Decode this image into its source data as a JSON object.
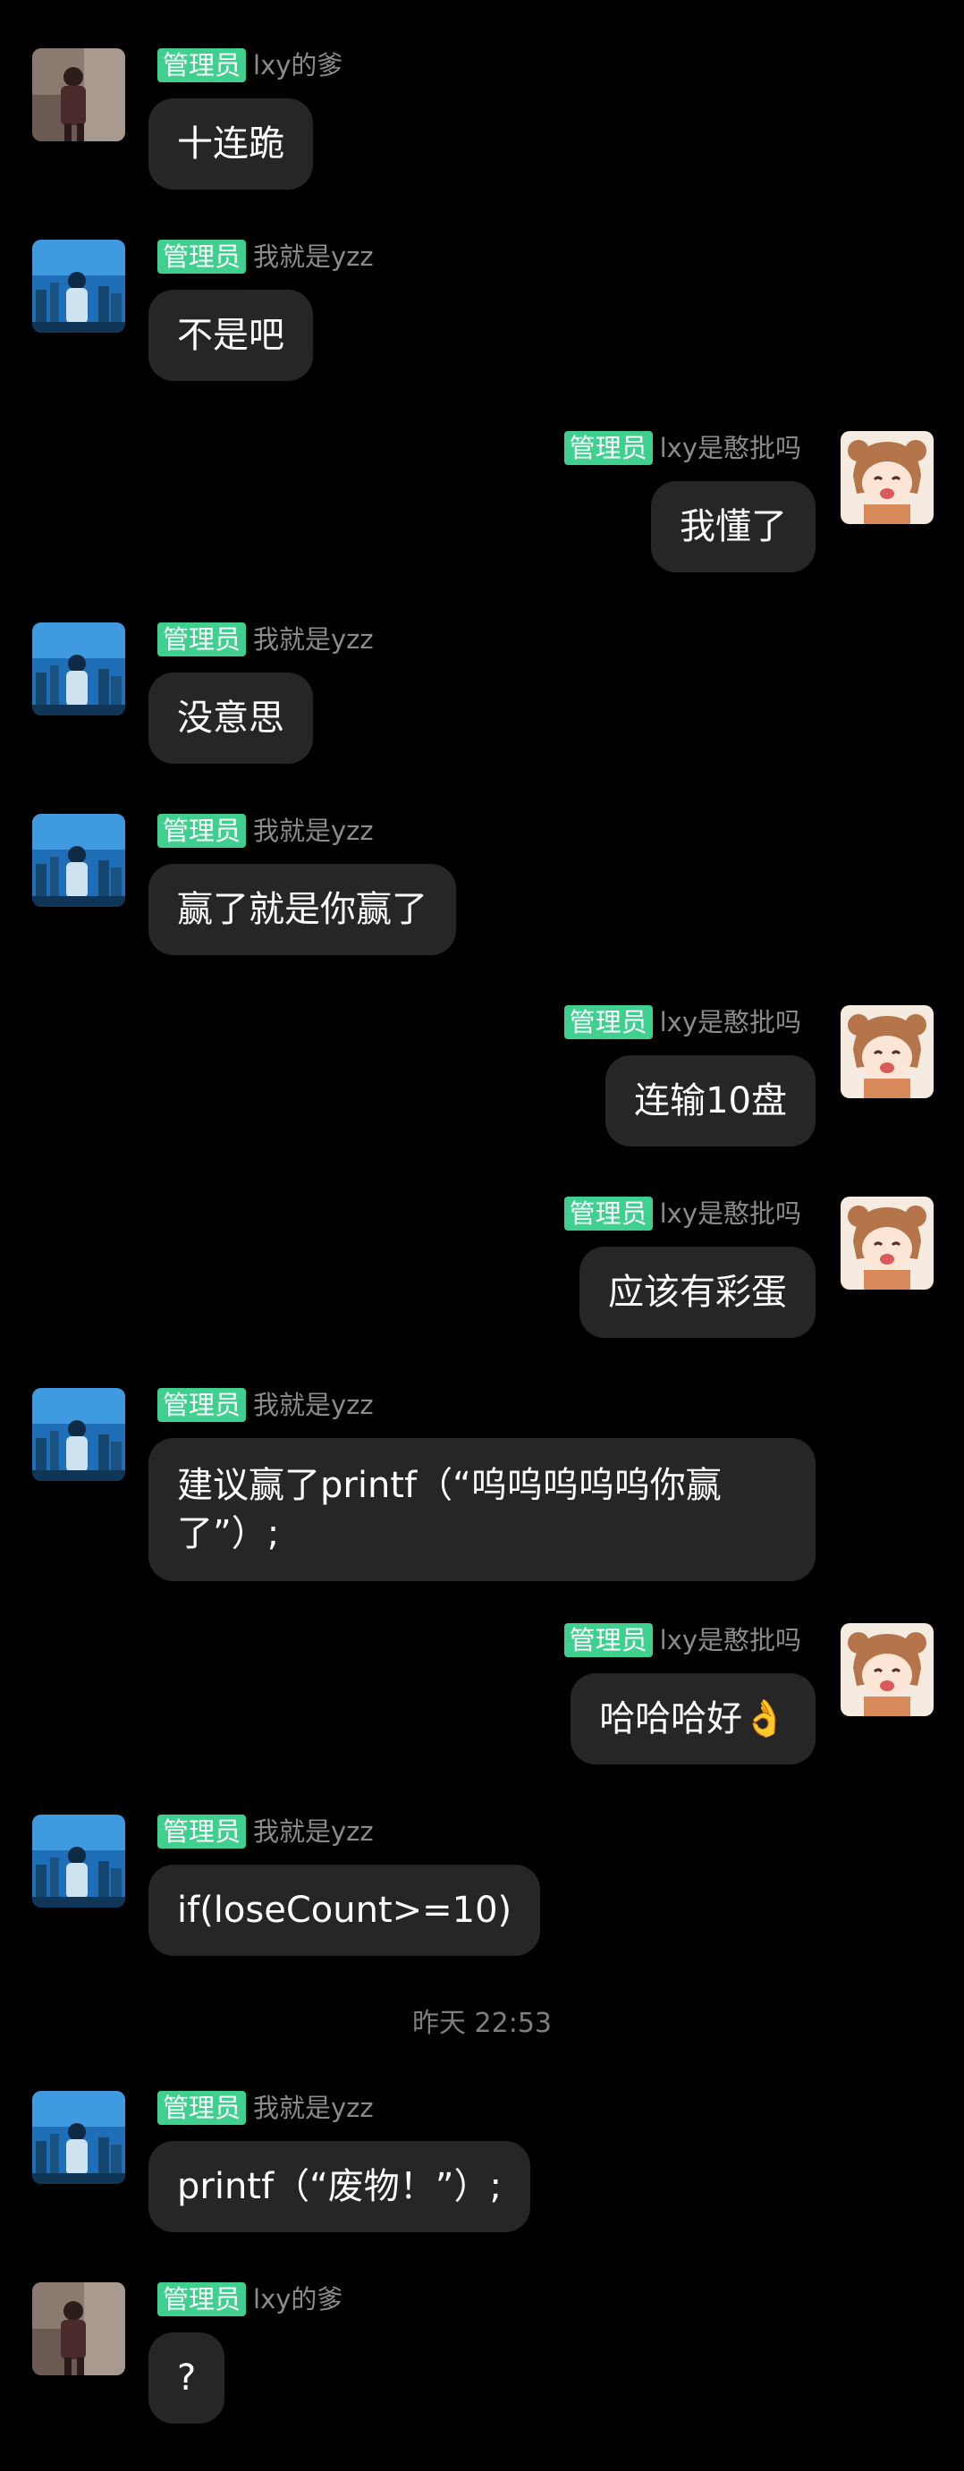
{
  "colors": {
    "background": "#000000",
    "bubble": "#262626",
    "badge": "#3fcf8e",
    "name": "#8b8b8b",
    "timestamp": "#7e7e7e"
  },
  "messages": [
    {
      "side": "left",
      "avatar": "lxy-father-avatar",
      "badge": "管理员",
      "name": "lxy的爹",
      "text": "十连跪"
    },
    {
      "side": "left",
      "avatar": "yzz-avatar",
      "badge": "管理员",
      "name": "我就是yzz",
      "text": "不是吧"
    },
    {
      "side": "right",
      "avatar": "anime-girl-avatar",
      "badge": "管理员",
      "name": "lxy是憨批吗",
      "text": "我懂了"
    },
    {
      "side": "left",
      "avatar": "yzz-avatar",
      "badge": "管理员",
      "name": "我就是yzz",
      "text": "没意思"
    },
    {
      "side": "left",
      "avatar": "yzz-avatar",
      "badge": "管理员",
      "name": "我就是yzz",
      "text": "赢了就是你赢了"
    },
    {
      "side": "right",
      "avatar": "anime-girl-avatar",
      "badge": "管理员",
      "name": "lxy是憨批吗",
      "text": "连输10盘"
    },
    {
      "side": "right",
      "avatar": "anime-girl-avatar",
      "badge": "管理员",
      "name": "lxy是憨批吗",
      "text": "应该有彩蛋"
    },
    {
      "side": "left",
      "avatar": "yzz-avatar",
      "badge": "管理员",
      "name": "我就是yzz",
      "text": "建议赢了printf（“呜呜呜呜呜你赢了”）;"
    },
    {
      "side": "right",
      "avatar": "anime-girl-avatar",
      "badge": "管理员",
      "name": "lxy是憨批吗",
      "text": "哈哈哈好👌"
    },
    {
      "side": "left",
      "avatar": "yzz-avatar",
      "badge": "管理员",
      "name": "我就是yzz",
      "text": "if(loseCount>=10)"
    },
    {
      "side": "left",
      "avatar": "yzz-avatar",
      "badge": "管理员",
      "name": "我就是yzz",
      "text": "printf（“废物！”）;"
    },
    {
      "side": "left",
      "avatar": "lxy-father-avatar",
      "badge": "管理员",
      "name": "lxy的爹",
      "text": "?"
    }
  ],
  "timestamp": "昨天 22:53"
}
